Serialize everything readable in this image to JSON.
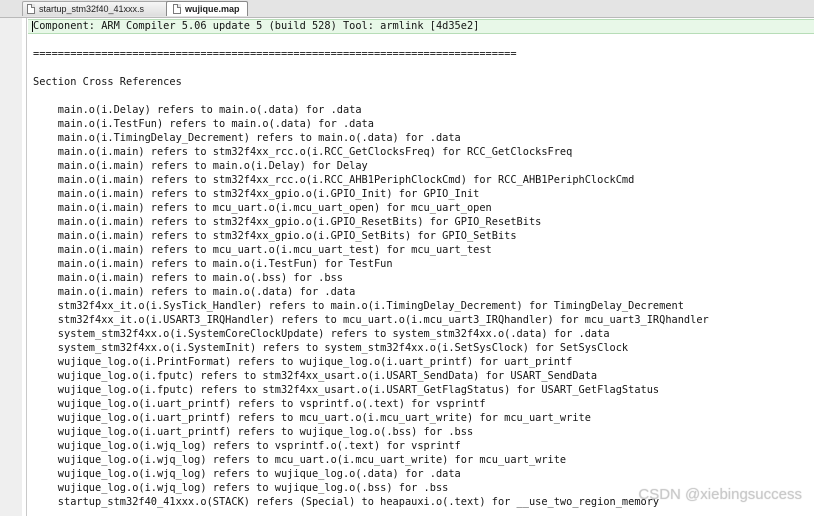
{
  "tabs": [
    {
      "label": "startup_stm32f40_41xxx.s",
      "active": false
    },
    {
      "label": "wujique.map",
      "active": true
    }
  ],
  "editor": {
    "lines": [
      "Component: ARM Compiler 5.06 update 5 (build 528) Tool: armlink [4d35e2]",
      "",
      "==============================================================================",
      "",
      "Section Cross References",
      "",
      "    main.o(i.Delay) refers to main.o(.data) for .data",
      "    main.o(i.TestFun) refers to main.o(.data) for .data",
      "    main.o(i.TimingDelay_Decrement) refers to main.o(.data) for .data",
      "    main.o(i.main) refers to stm32f4xx_rcc.o(i.RCC_GetClocksFreq) for RCC_GetClocksFreq",
      "    main.o(i.main) refers to main.o(i.Delay) for Delay",
      "    main.o(i.main) refers to stm32f4xx_rcc.o(i.RCC_AHB1PeriphClockCmd) for RCC_AHB1PeriphClockCmd",
      "    main.o(i.main) refers to stm32f4xx_gpio.o(i.GPIO_Init) for GPIO_Init",
      "    main.o(i.main) refers to mcu_uart.o(i.mcu_uart_open) for mcu_uart_open",
      "    main.o(i.main) refers to stm32f4xx_gpio.o(i.GPIO_ResetBits) for GPIO_ResetBits",
      "    main.o(i.main) refers to stm32f4xx_gpio.o(i.GPIO_SetBits) for GPIO_SetBits",
      "    main.o(i.main) refers to mcu_uart.o(i.mcu_uart_test) for mcu_uart_test",
      "    main.o(i.main) refers to main.o(i.TestFun) for TestFun",
      "    main.o(i.main) refers to main.o(.bss) for .bss",
      "    main.o(i.main) refers to main.o(.data) for .data",
      "    stm32f4xx_it.o(i.SysTick_Handler) refers to main.o(i.TimingDelay_Decrement) for TimingDelay_Decrement",
      "    stm32f4xx_it.o(i.USART3_IRQHandler) refers to mcu_uart.o(i.mcu_uart3_IRQhandler) for mcu_uart3_IRQhandler",
      "    system_stm32f4xx.o(i.SystemCoreClockUpdate) refers to system_stm32f4xx.o(.data) for .data",
      "    system_stm32f4xx.o(i.SystemInit) refers to system_stm32f4xx.o(i.SetSysClock) for SetSysClock",
      "    wujique_log.o(i.PrintFormat) refers to wujique_log.o(i.uart_printf) for uart_printf",
      "    wujique_log.o(i.fputc) refers to stm32f4xx_usart.o(i.USART_SendData) for USART_SendData",
      "    wujique_log.o(i.fputc) refers to stm32f4xx_usart.o(i.USART_GetFlagStatus) for USART_GetFlagStatus",
      "    wujique_log.o(i.uart_printf) refers to vsprintf.o(.text) for vsprintf",
      "    wujique_log.o(i.uart_printf) refers to mcu_uart.o(i.mcu_uart_write) for mcu_uart_write",
      "    wujique_log.o(i.uart_printf) refers to wujique_log.o(.bss) for .bss",
      "    wujique_log.o(i.wjq_log) refers to vsprintf.o(.text) for vsprintf",
      "    wujique_log.o(i.wjq_log) refers to mcu_uart.o(i.mcu_uart_write) for mcu_uart_write",
      "    wujique_log.o(i.wjq_log) refers to wujique_log.o(.data) for .data",
      "    wujique_log.o(i.wjq_log) refers to wujique_log.o(.bss) for .bss",
      "    startup_stm32f40_41xxx.o(STACK) refers (Special) to heapauxi.o(.text) for __use_two_region_memory"
    ]
  },
  "watermark": "CSDN @xiebingsuccess"
}
